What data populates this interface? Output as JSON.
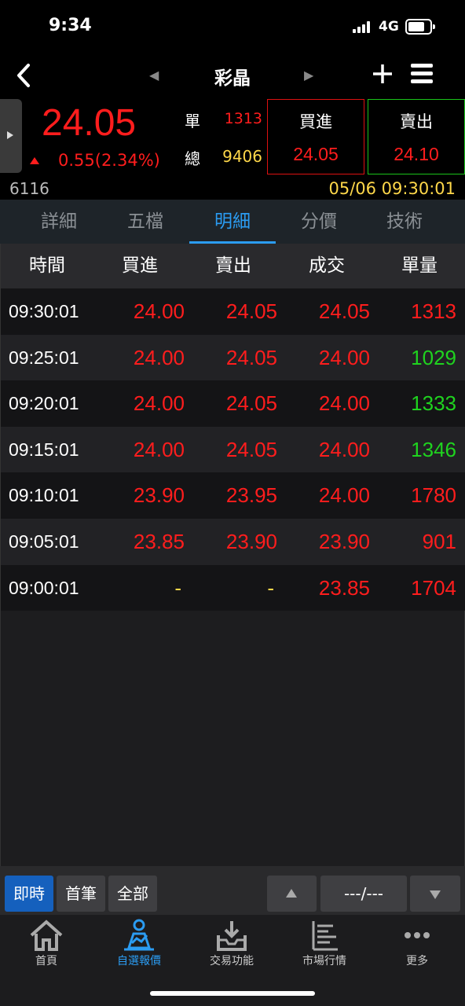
{
  "status_bar": {
    "time": "9:34",
    "network": "4G"
  },
  "nav": {
    "title": "彩晶"
  },
  "quote": {
    "price": "24.05",
    "change": "0.55(2.34%)",
    "single_label": "單",
    "single_value": "1313",
    "total_label": "總",
    "total_value": "9406",
    "buy_label": "買進",
    "buy_price": "24.05",
    "sell_label": "賣出",
    "sell_price": "24.10",
    "code": "6116",
    "datetime": "05/06 09:30:01"
  },
  "tabs": [
    "詳細",
    "五檔",
    "明細",
    "分價",
    "技術"
  ],
  "active_tab": 2,
  "table": {
    "headers": [
      "時間",
      "買進",
      "賣出",
      "成交",
      "單量"
    ],
    "rows": [
      {
        "time": "09:30:01",
        "bid": "24.00",
        "ask": "24.05",
        "deal": "24.05",
        "vol": "1313",
        "vol_color": "#ff1d1d"
      },
      {
        "time": "09:25:01",
        "bid": "24.00",
        "ask": "24.05",
        "deal": "24.00",
        "vol": "1029",
        "vol_color": "#1fd31f"
      },
      {
        "time": "09:20:01",
        "bid": "24.00",
        "ask": "24.05",
        "deal": "24.00",
        "vol": "1333",
        "vol_color": "#1fd31f"
      },
      {
        "time": "09:15:01",
        "bid": "24.00",
        "ask": "24.05",
        "deal": "24.00",
        "vol": "1346",
        "vol_color": "#1fd31f"
      },
      {
        "time": "09:10:01",
        "bid": "23.90",
        "ask": "23.95",
        "deal": "24.00",
        "vol": "1780",
        "vol_color": "#ff1d1d"
      },
      {
        "time": "09:05:01",
        "bid": "23.85",
        "ask": "23.90",
        "deal": "23.90",
        "vol": "901",
        "vol_color": "#ff1d1d"
      },
      {
        "time": "09:00:01",
        "bid": "-",
        "ask": "-",
        "deal": "23.85",
        "vol": "1704",
        "vol_color": "#ff1d1d"
      }
    ]
  },
  "controls": {
    "realtime": "即時",
    "first": "首筆",
    "all": "全部",
    "page": "---/---"
  },
  "tabbar": [
    {
      "label": "首頁",
      "icon": "home-icon"
    },
    {
      "label": "自選報價",
      "icon": "watchlist-icon"
    },
    {
      "label": "交易功能",
      "icon": "trade-icon"
    },
    {
      "label": "市場行情",
      "icon": "market-icon"
    },
    {
      "label": "更多",
      "icon": "more-icon"
    }
  ],
  "colors": {
    "up": "#ff1d1d",
    "down": "#1fd31f",
    "accent": "#2b9cf2",
    "highlight": "#ffd84a"
  }
}
